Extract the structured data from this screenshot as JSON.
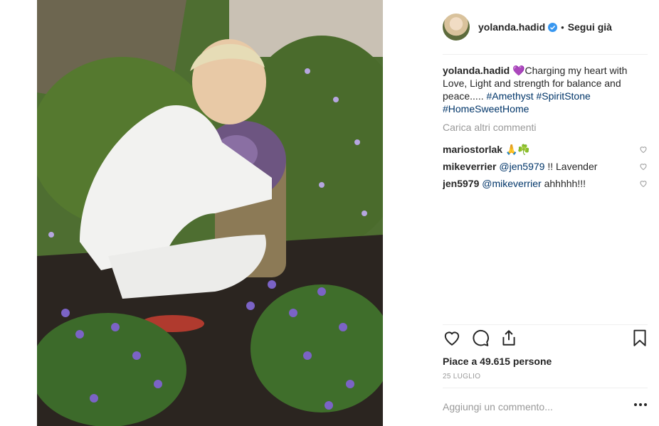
{
  "post": {
    "username": "yolanda.hadid",
    "follow_status": "Segui già",
    "separator": "•",
    "caption": {
      "user": "yolanda.hadid",
      "emoji": "💜",
      "text": "Charging my heart with Love, Light and strength for balance and peace..... ",
      "tags": [
        "#Amethyst",
        "#SpiritStone",
        "#HomeSweetHome"
      ]
    },
    "load_more": "Carica altri commenti",
    "comments": [
      {
        "user": "mariostorlak",
        "text": "🙏☘️"
      },
      {
        "user": "mikeverrier",
        "mention": "@jen5979",
        "text": " !! Lavender"
      },
      {
        "user": "jen5979",
        "mention": "@mikeverrier",
        "text": " ahhhhh!!!"
      }
    ],
    "likes_label": "Piace a 49.615 persone",
    "date": "25 LUGLIO",
    "add_comment_placeholder": "Aggiungi un commento..."
  },
  "icons": {
    "verified": "verified-badge-icon",
    "like": "heart-outline-icon",
    "comment": "speech-bubble-icon",
    "share": "share-upload-icon",
    "save": "bookmark-icon",
    "more": "more-options-icon"
  },
  "colors": {
    "verified_blue": "#3897f0",
    "hashtag": "#003569",
    "muted_text": "#999999",
    "divider": "#efefef"
  }
}
